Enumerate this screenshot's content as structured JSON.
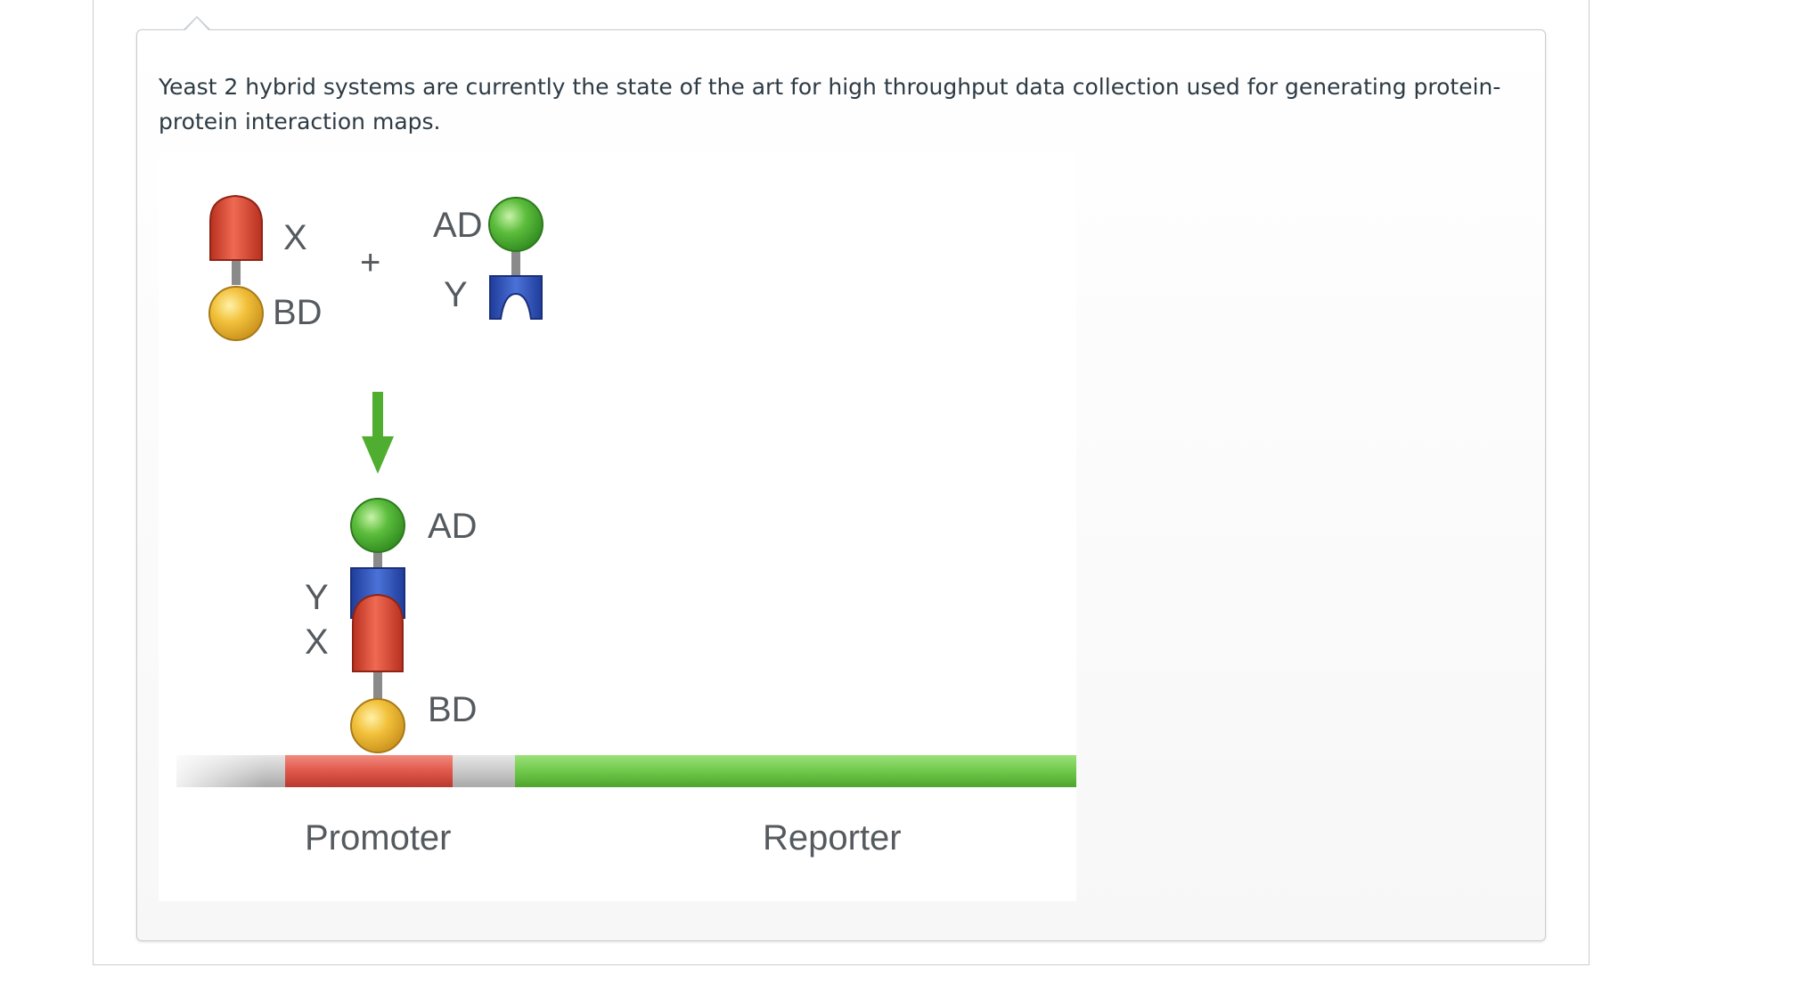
{
  "question": {
    "text": "Yeast 2 hybrid systems are currently the state of the art for high throughput data collection used for generating protein-protein interaction maps."
  },
  "diagram": {
    "labels": {
      "x_top": "X",
      "bd_top": "BD",
      "plus": "+",
      "ad_top": "AD",
      "y_top": "Y",
      "ad_bottom": "AD",
      "y_bottom": "Y",
      "x_bottom": "X",
      "bd_bottom": "BD",
      "promoter": "Promoter",
      "reporter": "Reporter"
    },
    "colors": {
      "red_protein": "#d8442f",
      "yellow_bd": "#f2c13b",
      "green_ad": "#5cbd3c",
      "blue_protein": "#2f55c4",
      "reporter_green": "#6fc94a",
      "promoter_red": "#e0574a",
      "arrow_green": "#4fae2f"
    }
  }
}
